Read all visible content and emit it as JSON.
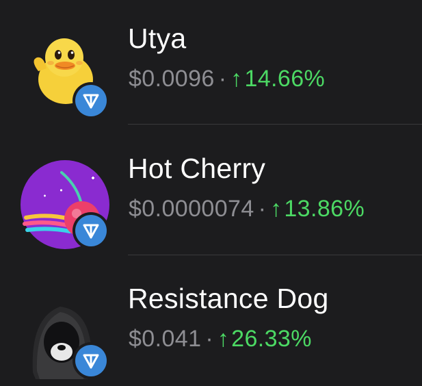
{
  "tokens": [
    {
      "name": "Utya",
      "price": "$0.0096",
      "separator": "·",
      "change_arrow": "↑",
      "change": "14.66%",
      "avatar_icon": "yellow-duck",
      "chain_icon": "ton-badge"
    },
    {
      "name": "Hot Cherry",
      "price": "$0.0000074",
      "separator": "·",
      "change_arrow": "↑",
      "change": "13.86%",
      "avatar_icon": "cherry-on-purple",
      "chain_icon": "ton-badge"
    },
    {
      "name": "Resistance Dog",
      "price": "$0.041",
      "separator": "·",
      "change_arrow": "↑",
      "change": "26.33%",
      "avatar_icon": "hooded-dog",
      "chain_icon": "ton-badge"
    }
  ],
  "colors": {
    "background": "#1c1c1e",
    "name_text": "#ffffff",
    "price_text": "#8e8e93",
    "positive_change": "#4cd964",
    "ton_badge": "#3a87d8",
    "divider": "#3a3a3c"
  }
}
